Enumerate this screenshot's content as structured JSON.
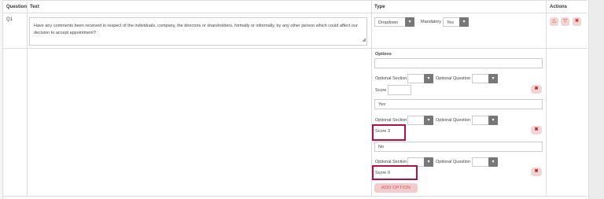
{
  "table": {
    "headers": {
      "question": "Question",
      "text": "Text",
      "type": "Type",
      "actions": "Actions"
    }
  },
  "row": {
    "id": "Q1",
    "text": "Have any comments been received in respect of the individuals, company, the directors or shareholders, formally or informally, by any other person which could affect our decision to accept appointment?",
    "type_value": "Dropdown",
    "mandatory_label": "Mandatory",
    "mandatory_value": "Yes"
  },
  "options": {
    "title": "Options",
    "optional_section_label": "Optional Section",
    "optional_question_label": "Optional Question",
    "score_label": "Score",
    "items": [
      {
        "value": "",
        "score": ""
      },
      {
        "value": "Yes",
        "score": "3"
      },
      {
        "value": "No",
        "score": "0"
      }
    ],
    "add_option_label": "ADD OPTION"
  },
  "icons": {
    "move_up": "triangle-up-icon",
    "move_down": "triangle-down-icon",
    "delete": "close-icon",
    "dropdown": "chevron-down-icon"
  },
  "colors": {
    "highlight": "#b3103f",
    "action_button_bg": "#f3d4d4",
    "dropdown_arrow_bg": "#777777"
  }
}
